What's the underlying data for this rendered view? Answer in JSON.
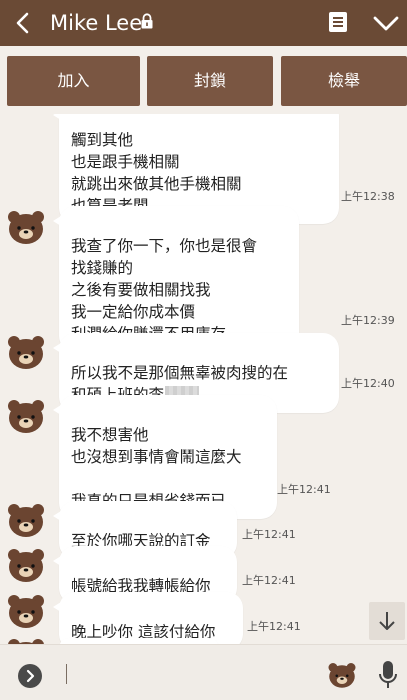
{
  "header": {
    "title": "Mike Lee",
    "background": "#6a4a35",
    "icons": [
      "back-chevron-icon",
      "lock-icon",
      "note-icon",
      "chevron-down-icon"
    ]
  },
  "actions": {
    "add_label": "加入",
    "block_label": "封鎖",
    "report_label": "檢舉",
    "button_color": "#7a5642"
  },
  "messages": [
    {
      "text": "觸到其他\n也是跟手機相關\n就跳出來做其他手機相關\n也算是老闆",
      "time": "上午12:38"
    },
    {
      "text": "我查了你一下，你也是很會\n找錢賺的\n之後有要做相關找我\n我一定給你成本價\n利潤給你賺還不用庫存",
      "time": "上午12:39"
    },
    {
      "text_part1": "所以我不是那個無辜被肉搜的在\n和碩上班的李",
      "time": "上午12:40"
    },
    {
      "text": "我不想害他\n也沒想到事情會鬧這麼大\n\n我真的只是想省錢而已",
      "time": "上午12:41"
    },
    {
      "text": "至於你哪天說的訂金",
      "time": "上午12:41"
    },
    {
      "text": "帳號給我我轉帳給你",
      "time": "上午12:41"
    },
    {
      "text": "晚上吵你  這該付給你",
      "time": "上午12:41"
    }
  ],
  "footer": {
    "input_value": "",
    "icons": [
      "expand-arrow-icon",
      "sticker-icon",
      "microphone-icon"
    ]
  },
  "colors": {
    "chat_background": "#f3efea",
    "bubble": "#ffffff"
  }
}
